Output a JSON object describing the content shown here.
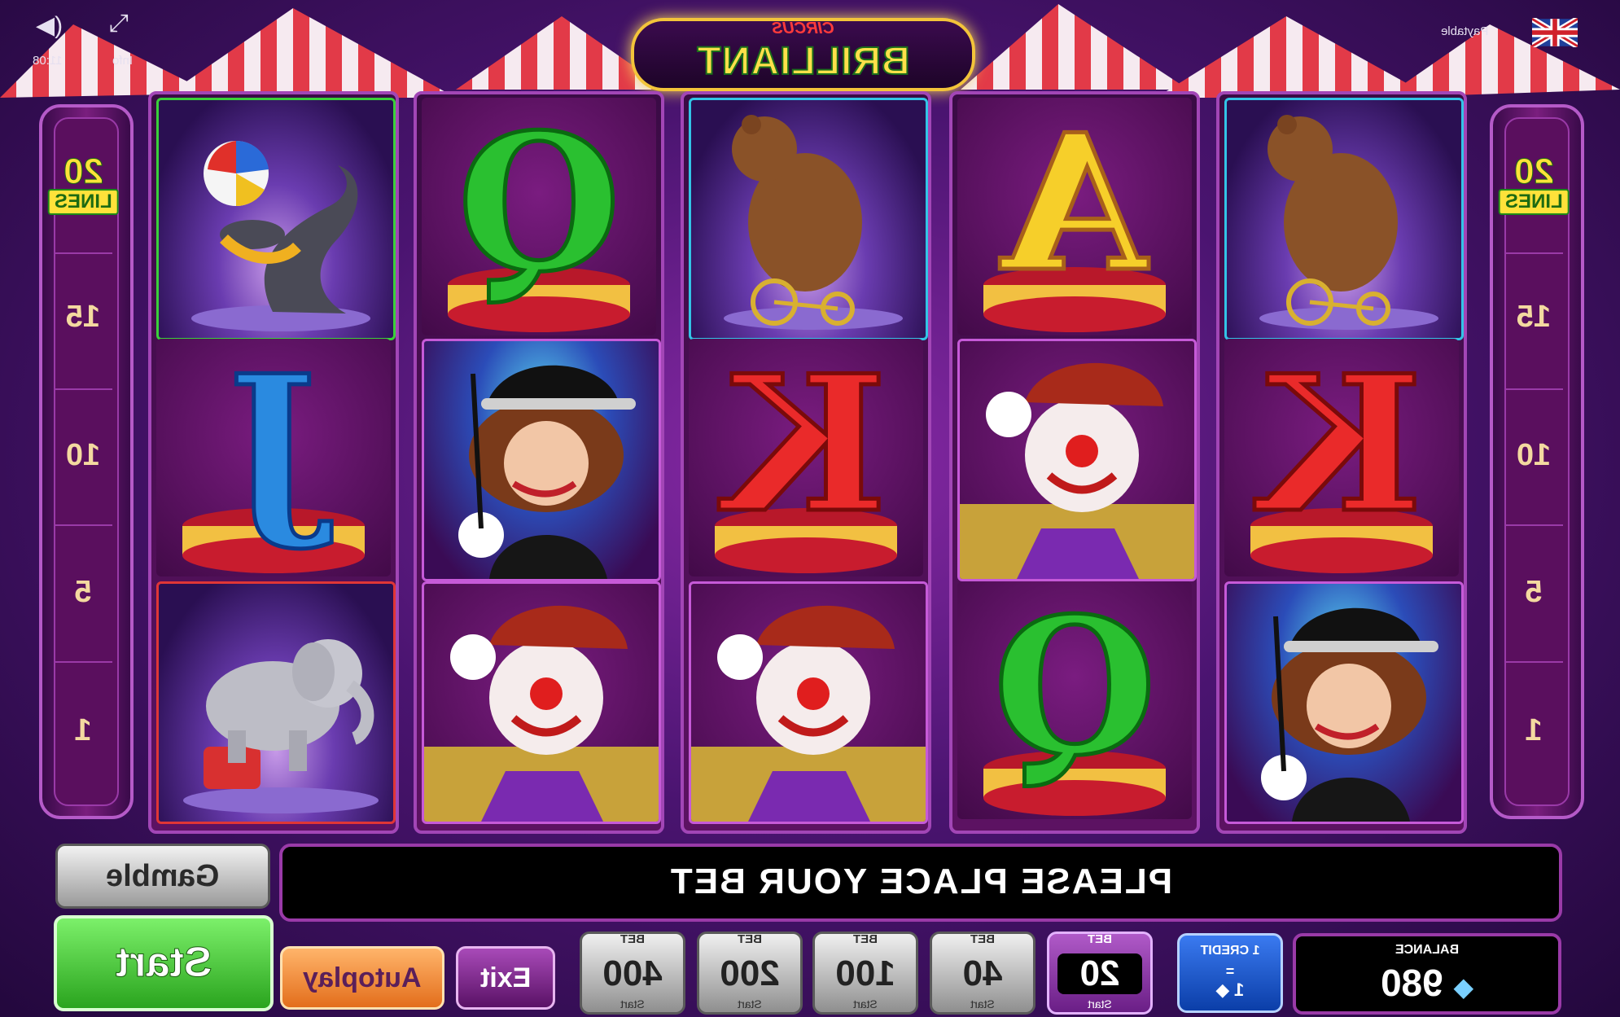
{
  "top": {
    "sound_icon": "speaker-icon",
    "fullscreen_icon": "fullscreen-icon",
    "time_text": "11:08",
    "secondary_text": "Info",
    "paytable_label": "Paytable",
    "flag": "uk-flag-icon"
  },
  "logo": {
    "circus": "CIRCUS",
    "name": "BRILLIANT"
  },
  "lines": {
    "count": "20",
    "word": "LINES",
    "markers": [
      "15",
      "10",
      "5",
      "1"
    ]
  },
  "reels": [
    [
      "seal",
      "letter-J",
      "elephant"
    ],
    [
      "letter-Q",
      "ringmaster-lady",
      "clown"
    ],
    [
      "bear",
      "letter-K",
      "clown"
    ],
    [
      "letter-A",
      "clown",
      "letter-Q"
    ],
    [
      "bear",
      "letter-K",
      "ringmaster-lady"
    ]
  ],
  "message": "PLEASE PLACE YOUR BET",
  "buttons": {
    "gamble": "Gamble",
    "start": "Start",
    "autoplay": "Autoplay",
    "exit": "Exit"
  },
  "bets": [
    {
      "caption": "BET",
      "value": "400",
      "sub": "Start"
    },
    {
      "caption": "BET",
      "value": "200",
      "sub": "Start"
    },
    {
      "caption": "BET",
      "value": "100",
      "sub": "Start"
    },
    {
      "caption": "BET",
      "value": "40",
      "sub": "Start"
    },
    {
      "caption": "BET",
      "value": "20",
      "sub": "Start"
    }
  ],
  "credit": {
    "label": "1 CREDIT",
    "equals": "=",
    "value": "1"
  },
  "balance": {
    "label": "BALANCE",
    "value": "980"
  },
  "colors": {
    "accent": "#a246b6",
    "start": "#2aa41e",
    "autoplay": "#e36e1c",
    "credit": "#0b3ea8"
  }
}
